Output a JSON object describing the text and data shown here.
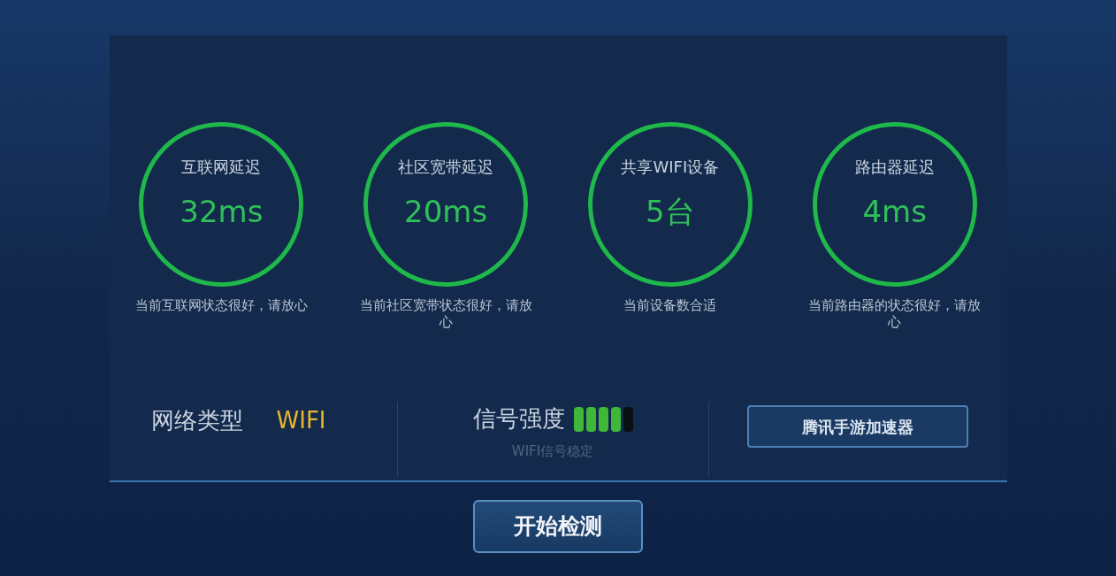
{
  "metrics": [
    {
      "title": "互联网延迟",
      "value": "32ms",
      "caption": "当前互联网状态很好，请放心"
    },
    {
      "title": "社区宽带延迟",
      "value": "20ms",
      "caption": "当前社区宽带状态很好，请放心"
    },
    {
      "title": "共享WIFI设备",
      "value": "5台",
      "caption": "当前设备数合适"
    },
    {
      "title": "路由器延迟",
      "value": "4ms",
      "caption": "当前路由器的状态很好，请放心"
    }
  ],
  "network_type": {
    "label": "网络类型",
    "value": "WIFI"
  },
  "signal": {
    "label": "信号强度",
    "level": 0.8,
    "caption": "WIFI信号稳定"
  },
  "accelerator_button": "腾讯手游加速器",
  "start_button": "开始检测"
}
